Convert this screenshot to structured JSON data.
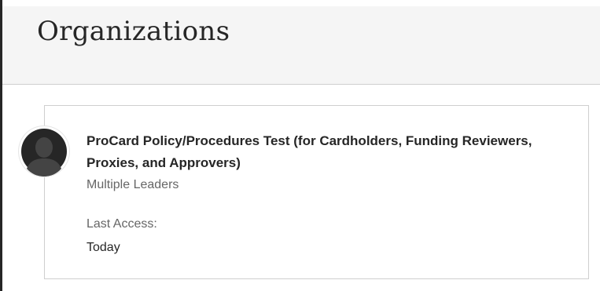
{
  "header": {
    "title": "Organizations"
  },
  "organizations": [
    {
      "title": "ProCard Policy/Procedures Test (for Cardholders, Funding Reviewers, Proxies, and Approvers)",
      "leaders": "Multiple Leaders",
      "last_access_label": "Last Access:",
      "last_access_value": "Today",
      "avatar_icon": "user-silhouette-icon"
    }
  ],
  "colors": {
    "page_background": "#f5f5f5",
    "card_background": "#ffffff",
    "border": "#cfcfcf",
    "text_primary": "#262626",
    "text_secondary": "#666666",
    "avatar_fill": "#262626"
  }
}
